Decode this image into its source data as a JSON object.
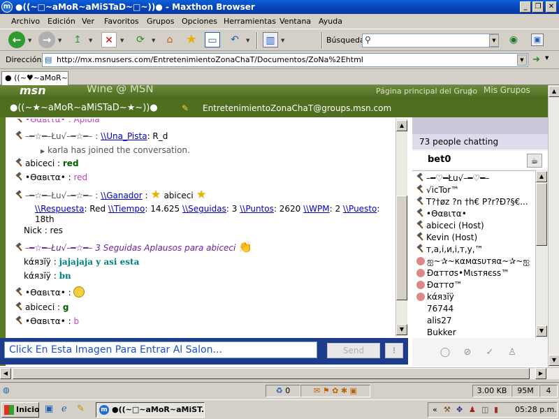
{
  "window": {
    "title": "●((~□~aMoR~aMiSTaD~□~))● - Maxthon Browser",
    "min_label": "_",
    "max_label": "❐",
    "close_label": "✕"
  },
  "menu": [
    "Archivo",
    "Edición",
    "Ver",
    "Favoritos",
    "Grupos",
    "Opciones",
    "Herramientas",
    "Ventana",
    "Ayuda"
  ],
  "toolbar": {
    "search_label": "Búsqueda",
    "search_value": ""
  },
  "address": {
    "label": "Dirección",
    "url": "http://mx.msnusers.com/EntretenimientoZonaChaT/Documentos/ZoNa%2Ehtml"
  },
  "tab": {
    "label": "((~♥~aMoR~a..."
  },
  "page": {
    "msn_logo": "msn",
    "msn_title": "Wine @ MSN",
    "group_home_link": "Página principal del Grupo",
    "my_groups_link": "Mis Grupos",
    "group_name": "●((~★~aMoR~aMiSTaD~★~))●",
    "group_email": "EntretenimientoZonaChaT@groups.msn.com"
  },
  "chat": {
    "top_partial": "•ϴαвιτα•  :  Apiola",
    "m1_name": "–━☆━–Łu√–━☆━– :",
    "m1_link": "\\\\Una_Pista",
    "m1_text": ": R_d",
    "join_text": "karla has joined the conversation.",
    "m2_name": "abiceci",
    "m2_text": "red",
    "m3_name": "•ϴαвιτα•",
    "m3_text": "red",
    "m4_name": "–━☆━–Łu√–━☆━– :",
    "m4_link": "\\\\Ganador",
    "m4_text": "abiceci",
    "m4_resp_link": "\\\\Respuesta",
    "m4_resp_val": ": Red",
    "m4_time_link": "\\\\Tiempo",
    "m4_time_val": ": 14.625",
    "m4_seg_link": "\\\\Seguidas",
    "m4_seg_val": ": 3",
    "m4_pts_link": "\\\\Puntos",
    "m4_pts_val": ": 2620",
    "m4_wpm_link": "\\\\WPM",
    "m4_wpm_val": ": 2",
    "m4_pos_link": "\\\\Puesto",
    "m4_pos_val": ":",
    "m4_pos_num": "18th",
    "m5_name": "Nick",
    "m5_text": ": res",
    "m6_name": "–━☆━–Łu√–━☆━–",
    "m6_text": "3 Seguidas Aplausos para abiceci",
    "m7_name": "kάязĭÿ",
    "m7_text": "jajajaja y asi esta",
    "m8_name": "kάязĭÿ",
    "m8_text": "bn",
    "m9_name": "•ϴαвιτα•",
    "m10_name": "abiceci",
    "m10_text": "g",
    "m11_name": "•ϴαвιτα•",
    "m11_text": "b"
  },
  "input": {
    "value": "Click En Esta Imagen Para Entrar Al Salon...",
    "send_label": "Send",
    "exc_label": "!"
  },
  "people": {
    "count_text": "73 people chatting",
    "self_name": "bet0",
    "users": [
      "–━♡━Łu√–━♡━–",
      "√icTor™",
      "T?†øz ?n †h€ P?r?Ð?§€...",
      "•ϴαвιτα•",
      "abiceci (Host)",
      "Kevin (Host)",
      "т,а,і,и,і,т,у,™",
      "ஐ~✰~кαмαѕυтяα~✰~ஐ",
      "Ðαттσѕ•Mιѕтяєѕѕ™",
      "Ðαттσ™",
      "kάязĭÿ",
      "76744",
      "alis27",
      "Bukker"
    ]
  },
  "statusbar": {
    "count": "0",
    "size": "3.00 KB",
    "mem": "95M",
    "num": "4"
  },
  "taskbar": {
    "start_label": "Inicio",
    "task_label": "●((~□~aMoR~aMiST...",
    "clock": "05:28 p.m.",
    "tray_arrows": "«"
  }
}
